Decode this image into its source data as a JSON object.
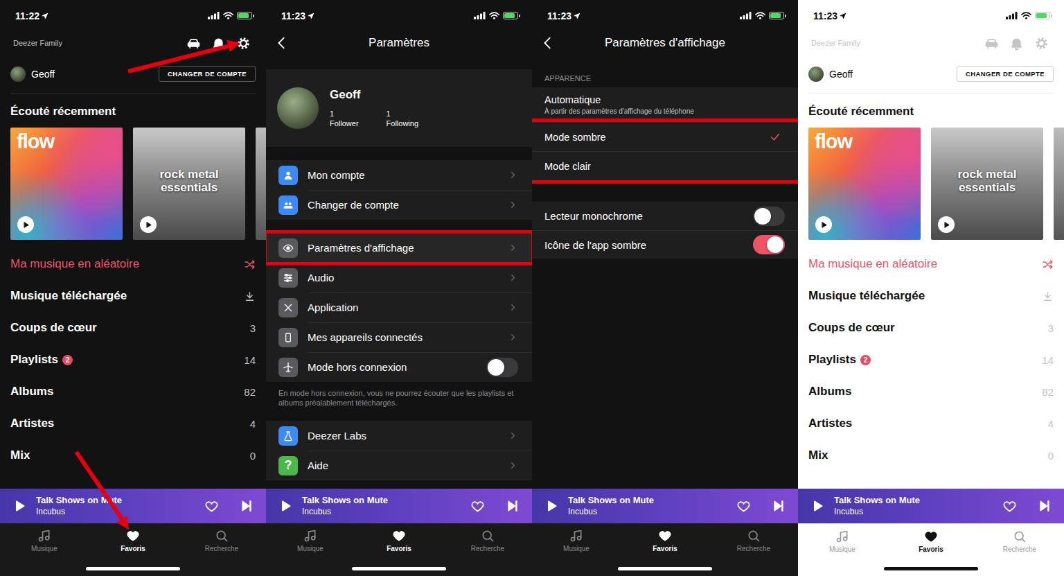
{
  "panels": [
    {
      "kind": "home",
      "theme": "dark",
      "status": {
        "time": "11:22",
        "battery": {
          "level": 0.85
        }
      },
      "header": {
        "account_type": "Deezer Family",
        "icons": [
          {
            "kind": "car",
            "highlighted": false
          },
          {
            "kind": "bell",
            "highlighted": false
          },
          {
            "kind": "gear",
            "highlighted": true
          }
        ]
      },
      "user": {
        "name": "Geoff",
        "button": "CHANGER DE COMPTE"
      },
      "recent": {
        "title": "Écouté récemment",
        "cards": [
          {
            "kind": "flow",
            "title": "flow"
          },
          {
            "kind": "photo",
            "title": "rock metal essentials"
          },
          {
            "kind": "partial"
          }
        ]
      },
      "list": [
        {
          "kind": "shuffle",
          "label": "Ma musique en aléatoire",
          "accent": true
        },
        {
          "kind": "download",
          "label": "Musique téléchargée",
          "accent": false
        },
        {
          "kind": "count",
          "label": "Coups de cœur",
          "count": "3",
          "accent": false
        },
        {
          "kind": "count",
          "label": "Playlists",
          "badge": "2",
          "count": "14",
          "accent": false
        },
        {
          "kind": "count",
          "label": "Albums",
          "count": "82",
          "accent": false
        },
        {
          "kind": "count",
          "label": "Artistes",
          "count": "4",
          "accent": false
        },
        {
          "kind": "count",
          "label": "Mix",
          "count": "0",
          "accent": false
        }
      ],
      "player": {
        "title": "Talk Shows on Mute",
        "artist": "Incubus",
        "liked": false
      },
      "tabs": [
        {
          "kind": "music",
          "label": "Musique",
          "selected": false,
          "highlighted": false
        },
        {
          "kind": "heart",
          "label": "Favoris",
          "selected": true,
          "highlighted": true
        },
        {
          "kind": "search",
          "label": "Recherche",
          "selected": false,
          "highlighted": false
        }
      ]
    },
    {
      "kind": "settings",
      "theme": "dark",
      "status": {
        "time": "11:23",
        "battery": {
          "level": 0.85
        }
      },
      "title": "Paramètres",
      "profile": {
        "name": "Geoff",
        "stats": [
          {
            "value": "1",
            "label": "Follower"
          },
          {
            "value": "1",
            "label": "Following"
          }
        ]
      },
      "groups": [
        {
          "items": [
            {
              "kind": "user",
              "label": "Mon compte",
              "color": "#3d8bf2",
              "highlighted": false
            },
            {
              "kind": "users",
              "label": "Changer de compte",
              "color": "#3d8bf2",
              "highlighted": false
            }
          ]
        },
        {
          "items": [
            {
              "kind": "eye",
              "label": "Paramètres d'affichage",
              "color": "#5a5a5e",
              "highlighted": true
            },
            {
              "kind": "sliders",
              "label": "Audio",
              "color": "#5a5a5e",
              "highlighted": false
            },
            {
              "kind": "tools",
              "label": "Application",
              "color": "#5a5a5e",
              "highlighted": false
            },
            {
              "kind": "phone",
              "label": "Mes appareils connectés",
              "color": "#5a5a5e",
              "highlighted": false
            },
            {
              "kind": "plane",
              "label": "Mode hors connexion",
              "color": "#5a5a5e",
              "highlighted": false,
              "on": false
            }
          ],
          "note": "En mode hors connexion, vous ne pourrez écouter que les playlists et albums préalablement téléchargés."
        },
        {
          "items": [
            {
              "kind": "flask",
              "label": "Deezer Labs",
              "color": "#3d8bf2",
              "highlighted": false
            },
            {
              "glyph": "?",
              "label": "Aide",
              "color": "#4cb84c",
              "highlighted": false
            }
          ]
        }
      ],
      "player": {
        "title": "Talk Shows on Mute",
        "artist": "Incubus",
        "liked": false
      },
      "tabs": [
        {
          "kind": "music",
          "label": "Musique",
          "selected": false,
          "highlighted": false
        },
        {
          "kind": "heart",
          "label": "Favoris",
          "selected": true,
          "highlighted": false
        },
        {
          "kind": "search",
          "label": "Recherche",
          "selected": false,
          "highlighted": false
        }
      ]
    },
    {
      "kind": "display",
      "theme": "dark",
      "status": {
        "time": "11:23",
        "battery": {
          "level": 0.85
        }
      },
      "title": "Paramètres d'affichage",
      "section": "APPARENCE",
      "options": [
        {
          "label": "Automatique",
          "sub": "À partir des paramètres d'affichage du téléphone",
          "selected": false,
          "highlighted": false
        },
        {
          "label": "Mode sombre",
          "selected": true,
          "highlighted": true
        },
        {
          "label": "Mode clair",
          "selected": false,
          "highlighted": true
        }
      ],
      "toggles": [
        {
          "label": "Lecteur monochrome",
          "on": false
        },
        {
          "label": "Icône de l'app sombre",
          "on": true
        }
      ],
      "player": {
        "title": "Talk Shows on Mute",
        "artist": "Incubus",
        "liked": false
      },
      "tabs": [
        {
          "kind": "music",
          "label": "Musique",
          "selected": false,
          "highlighted": false
        },
        {
          "kind": "heart",
          "label": "Favoris",
          "selected": true,
          "highlighted": false
        },
        {
          "kind": "search",
          "label": "Recherche",
          "selected": false,
          "highlighted": false
        }
      ]
    },
    {
      "kind": "home",
      "theme": "light",
      "status": {
        "time": "11:23",
        "battery": {
          "level": 0.85
        }
      },
      "header": {
        "account_type": "Deezer Family",
        "icons": [
          {
            "kind": "car",
            "highlighted": false
          },
          {
            "kind": "bell",
            "highlighted": false
          },
          {
            "kind": "gear",
            "highlighted": false
          }
        ]
      },
      "user": {
        "name": "Geoff",
        "button": "CHANGER DE COMPTE"
      },
      "recent": {
        "title": "Écouté récemment",
        "cards": [
          {
            "kind": "flow",
            "title": "flow"
          },
          {
            "kind": "photo",
            "title": "rock metal essentials"
          },
          {
            "kind": "partial"
          }
        ]
      },
      "list": [
        {
          "kind": "shuffle",
          "label": "Ma musique en aléatoire",
          "accent": true
        },
        {
          "kind": "download",
          "label": "Musique téléchargée",
          "accent": false
        },
        {
          "kind": "count",
          "label": "Coups de cœur",
          "count": "3",
          "accent": false
        },
        {
          "kind": "count",
          "label": "Playlists",
          "badge": "2",
          "count": "14",
          "accent": false
        },
        {
          "kind": "count",
          "label": "Albums",
          "count": "82",
          "accent": false
        },
        {
          "kind": "count",
          "label": "Artistes",
          "count": "4",
          "accent": false
        },
        {
          "kind": "count",
          "label": "Mix",
          "count": "0",
          "accent": false
        }
      ],
      "player": {
        "title": "Talk Shows on Mute",
        "artist": "Incubus",
        "liked": false
      },
      "tabs": [
        {
          "kind": "music",
          "label": "Musique",
          "selected": false,
          "highlighted": false
        },
        {
          "kind": "heart",
          "label": "Favoris",
          "selected": true,
          "highlighted": false
        },
        {
          "kind": "search",
          "label": "Recherche",
          "selected": false,
          "highlighted": false
        }
      ]
    }
  ]
}
